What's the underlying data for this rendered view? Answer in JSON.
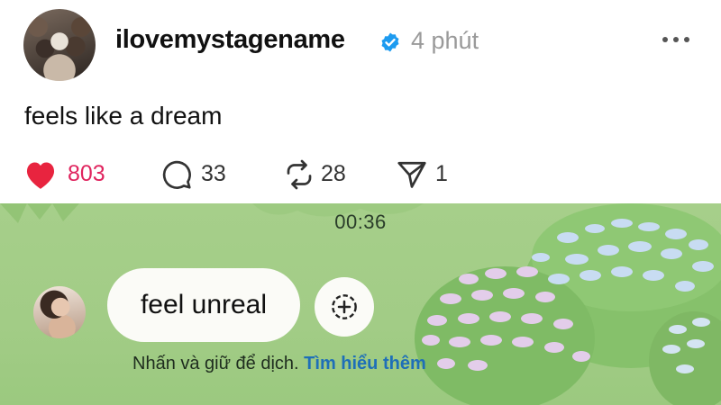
{
  "post": {
    "username": "ilovemystagename",
    "time": "4 phút",
    "text": "feels like a dream",
    "likes": "803",
    "comments": "33",
    "reposts": "28",
    "shares": "1"
  },
  "video": {
    "timestamp": "00:36",
    "caption": "feel unreal",
    "hint_text": "Nhấn và giữ để dịch.",
    "learn_more": "Tìm hiểu thêm"
  },
  "icons": {
    "verified": "verified-badge-icon",
    "more": "more-dots-icon",
    "like": "heart-icon",
    "comment": "comment-icon",
    "repost": "repost-icon",
    "share": "send-icon",
    "add": "add-circle-icon"
  },
  "colors": {
    "like_red": "#e0245e",
    "verified_blue": "#1d9bf0",
    "link_blue": "#1e6fb8",
    "video_green": "#a6cf8a"
  }
}
